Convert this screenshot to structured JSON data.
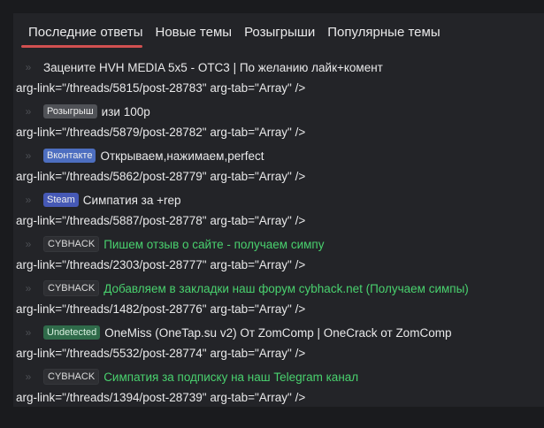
{
  "tabs": [
    {
      "label": "Последние ответы",
      "active": true
    },
    {
      "label": "Новые темы",
      "active": false
    },
    {
      "label": "Розыгрыши",
      "active": false
    },
    {
      "label": "Популярные темы",
      "active": false
    }
  ],
  "bullet_char": "»",
  "colors": {
    "accent_underline": "#d15050",
    "green_title": "#49d16e",
    "panel_bg": "#232428"
  },
  "items": [
    {
      "badge": "",
      "title": "Зацените HVH MEDIA 5x5 - OTC3 | По желанию лайк+комент",
      "attr": "arg-link=\"/threads/5815/post-28783\" arg-tab=\"Array\" />"
    },
    {
      "badge": "Розыгрыш",
      "title": "изи 100р",
      "attr": "arg-link=\"/threads/5879/post-28782\" arg-tab=\"Array\" />"
    },
    {
      "badge": "Вконтакте",
      "title": "Открываем,нажимаем,perfect",
      "attr": "arg-link=\"/threads/5862/post-28779\" arg-tab=\"Array\" />"
    },
    {
      "badge": "Steam",
      "title": "Симпатия за +rep",
      "attr": "arg-link=\"/threads/5887/post-28778\" arg-tab=\"Array\" />"
    },
    {
      "badge": "CYBHACK",
      "title": "Пишем отзыв о сайте - получаем симпу",
      "attr": "arg-link=\"/threads/2303/post-28777\" arg-tab=\"Array\" />"
    },
    {
      "badge": "CYBHACK",
      "title": "Добавляем в закладки наш форум cybhack.net (Получаем симпы)",
      "attr": "arg-link=\"/threads/1482/post-28776\" arg-tab=\"Array\" />"
    },
    {
      "badge": "Undetected",
      "title": "OneMiss (OneTap.su v2) От ZomComp | OneCrack от ZomComp",
      "attr": "arg-link=\"/threads/5532/post-28774\" arg-tab=\"Array\" />"
    },
    {
      "badge": "CYBHACK",
      "title": "Симпатия за подписку на наш Telegram канал",
      "attr": "arg-link=\"/threads/1394/post-28739\" arg-tab=\"Array\" />"
    }
  ]
}
